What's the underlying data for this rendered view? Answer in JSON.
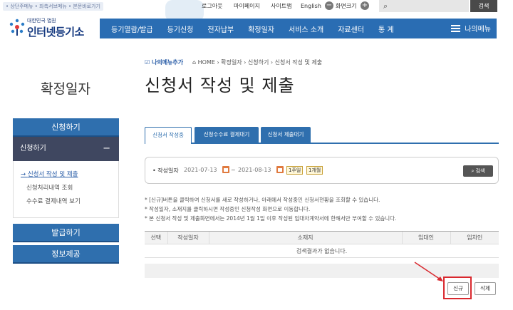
{
  "top": {
    "skip_links": "• 상단주메뉴 • 좌측서브메뉴 • 본문바로가기",
    "logout": "로그아웃",
    "mypage": "마이페이지",
    "sitemap": "사이트맵",
    "english": "English",
    "zoom_label": "화면크기",
    "zoom_minus": "−",
    "zoom_plus": "+",
    "search_placeholder": "",
    "search_button": "검색"
  },
  "logo": {
    "sub": "대한민국 법원",
    "main": "인터넷등기소"
  },
  "gnb": {
    "items": [
      "등기열람/발급",
      "등기신청",
      "전자납부",
      "확정일자",
      "서비스 소개",
      "자료센터",
      "통 계"
    ],
    "my_menu": "나의메뉴"
  },
  "sidebar": {
    "title": "확정일자",
    "section": "신청하기",
    "sub": "신청하기",
    "sub_toggle": "−",
    "links": [
      "신청서 작성 및 제출",
      "신청처리내역 조회",
      "수수료 결제내역 보기"
    ],
    "issue_btn": "발급하기",
    "info_btn": "정보제공"
  },
  "content": {
    "fav_label": "나의메뉴추가",
    "breadcrumb": "HOME › 확정일자 › 신청하기 › 신청서 작성 및 제출",
    "title": "신청서 작성 및 제출",
    "tabs": [
      "신청서 작성중",
      "신청수수료 결제대기",
      "신청서 제출대기"
    ],
    "search": {
      "label": "• 작성일자",
      "from": "2021-07-13",
      "to": "2021-08-13",
      "tilde": "~",
      "week": "1주일",
      "month": "1개월",
      "button": "검색"
    },
    "notes": [
      "* [신규]버튼을 클릭하여 신청서를 새로 작성하거나, 아래에서 작성중인 신청서현황을 조회할 수 있습니다.",
      "* 작성일자, 소재지를 클릭하시면 작성중인 신청작성 화면으로 이동합니다.",
      "* 본 신청서 작성 및 제출화면에서는 2014년 1월 1일 이후 작성된 임대차계약서에 한해서만 부여할 수 있습니다."
    ],
    "table": {
      "headers": [
        "선택",
        "작성일자",
        "소재지",
        "임대인",
        "임차인"
      ],
      "empty": "검색결과가 없습니다."
    },
    "new_button": "신규",
    "delete_button": "삭제"
  },
  "colors": {
    "nav_blue": "#2a6db3",
    "side_dark": "#3f4760",
    "highlight_red": "#d9282e",
    "calendar_orange": "#e07a3f"
  }
}
